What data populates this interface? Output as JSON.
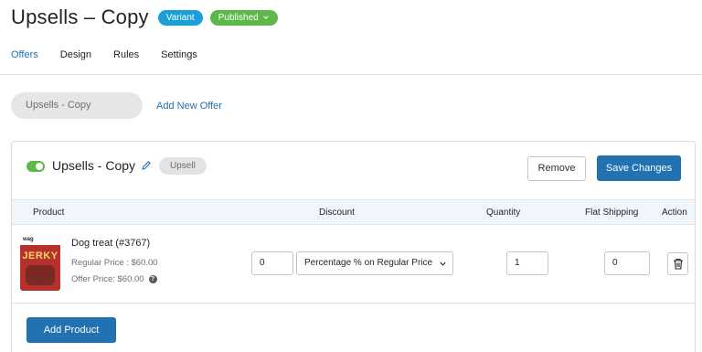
{
  "header": {
    "title": "Upsells – Copy",
    "variant_badge": "Variant",
    "status_badge": "Published"
  },
  "tabs": [
    {
      "label": "Offers",
      "active": true
    },
    {
      "label": "Design",
      "active": false
    },
    {
      "label": "Rules",
      "active": false
    },
    {
      "label": "Settings",
      "active": false
    }
  ],
  "offer_selector": {
    "current_offer": "Upsells - Copy",
    "add_new_label": "Add New Offer"
  },
  "offer": {
    "enabled": true,
    "title": "Upsells - Copy",
    "type_label": "Upsell",
    "remove_label": "Remove",
    "save_label": "Save Changes",
    "columns": {
      "product": "Product",
      "discount": "Discount",
      "quantity": "Quantity",
      "flat_shipping": "Flat Shipping",
      "action": "Action"
    },
    "products": [
      {
        "name": "Dog treat (#3767)",
        "regular_price": "Regular Price : $60.00",
        "offer_price": "Offer Price: $60.00",
        "thumbnail_brand": "wag",
        "thumbnail_text": "JERKY",
        "discount_value": "0",
        "discount_type": "Percentage % on Regular Price",
        "quantity": "1",
        "flat_shipping": "0"
      }
    ],
    "add_product_label": "Add Product"
  },
  "colors": {
    "accent": "#2271b1",
    "variant_badge": "#1a9fd6",
    "published_badge": "#5cb849",
    "toggle_on": "#5cb849"
  }
}
